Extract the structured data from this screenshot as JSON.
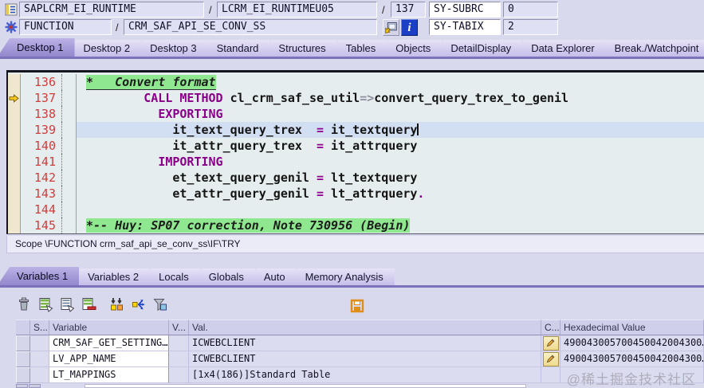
{
  "topbar": {
    "separator": "/",
    "program_field": "SAPLCRM_EI_RUNTIME",
    "include_field": "LCRM_EI_RUNTIMEU05",
    "line_field": "137",
    "sy_subrc_label": "SY-SUBRC",
    "sy_subrc_value": "0",
    "event_type_field": "FUNCTION",
    "event_name_field": "CRM_SAF_API_SE_CONV_SS",
    "sy_tabix_label": "SY-TABIX",
    "sy_tabix_value": "2",
    "info_glyph": "i",
    "icons": [
      "abap-program-icon",
      "function-module-icon",
      "goto-statement-icon",
      "info-icon"
    ]
  },
  "desktop_tabs": [
    {
      "label": "Desktop 1",
      "active": true
    },
    {
      "label": "Desktop 2"
    },
    {
      "label": "Desktop 3"
    },
    {
      "label": "Standard"
    },
    {
      "label": "Structures"
    },
    {
      "label": "Tables"
    },
    {
      "label": "Objects"
    },
    {
      "label": "DetailDisplay"
    },
    {
      "label": "Data Explorer"
    },
    {
      "label": "Break./Watchpoint"
    }
  ],
  "code": {
    "current_line": "137",
    "lines": [
      {
        "num": "136",
        "segments": [
          {
            "t": "*   Convert format",
            "s": "cm",
            "mark": true,
            "u": true
          }
        ]
      },
      {
        "num": "137",
        "arrow": true,
        "segments": [
          {
            "t": "        "
          },
          {
            "t": "CALL METHOD",
            "s": "k"
          },
          {
            "t": " cl_crm_saf_se_util",
            "s": ""
          },
          {
            "t": "=>",
            "s": "o"
          },
          {
            "t": "convert_query_trex_to_genil",
            "s": ""
          }
        ]
      },
      {
        "num": "138",
        "segments": [
          {
            "t": "          "
          },
          {
            "t": "EXPORTING",
            "s": "k"
          }
        ]
      },
      {
        "num": "139",
        "hl": true,
        "caret": true,
        "segments": [
          {
            "t": "            it_text_query_trex  ",
            "s": ""
          },
          {
            "t": "=",
            "s": "k"
          },
          {
            "t": " it_textquery",
            "s": ""
          }
        ]
      },
      {
        "num": "140",
        "segments": [
          {
            "t": "            it_attr_query_trex  ",
            "s": ""
          },
          {
            "t": "=",
            "s": "k"
          },
          {
            "t": " it_attrquery",
            "s": ""
          }
        ]
      },
      {
        "num": "141",
        "segments": [
          {
            "t": "          "
          },
          {
            "t": "IMPORTING",
            "s": "k"
          }
        ]
      },
      {
        "num": "142",
        "segments": [
          {
            "t": "            et_text_query_genil ",
            "s": ""
          },
          {
            "t": "=",
            "s": "k"
          },
          {
            "t": " lt_textquery",
            "s": ""
          }
        ]
      },
      {
        "num": "143",
        "segments": [
          {
            "t": "            et_attr_query_genil ",
            "s": ""
          },
          {
            "t": "=",
            "s": "k"
          },
          {
            "t": " lt_attrquery",
            "s": ""
          },
          {
            "t": ".",
            "s": "k"
          }
        ]
      },
      {
        "num": "144",
        "segments": []
      },
      {
        "num": "145",
        "segments": [
          {
            "t": "*-- Huy: SP07 correction, Note 730956 (Begin)",
            "s": "cm",
            "mark": true
          }
        ]
      }
    ]
  },
  "scope_bar": {
    "text": "Scope \\FUNCTION crm_saf_api_se_conv_ss\\IF\\TRY"
  },
  "variable_tabs": [
    {
      "label": "Variables 1",
      "active": true
    },
    {
      "label": "Variables 2"
    },
    {
      "label": "Locals"
    },
    {
      "label": "Globals"
    },
    {
      "label": "Auto"
    },
    {
      "label": "Memory Analysis"
    }
  ],
  "toolbar": {
    "icons": [
      "delete-icon",
      "table-create-icon",
      "table-display-icon",
      "table-delete-row-icon",
      "insert-values-icon",
      "swap-arrows-icon",
      "filter-funnel-icon"
    ],
    "save_icon": "save-icon",
    "pencil_icon": "change-value-pencil-icon",
    "arrow_icon": "current-statement-arrow-icon"
  },
  "table": {
    "columns": [
      "",
      "S...",
      "Variable",
      "V...",
      "Val.",
      "C...",
      "Hexadecimal Value"
    ],
    "rows": [
      {
        "variable": "CRM_SAF_GET_SETTING…",
        "value": "ICWEBCLIENT",
        "changeable": true,
        "hex": "490043005700450042004300…"
      },
      {
        "variable": "LV_APP_NAME",
        "value": "ICWEBCLIENT",
        "changeable": true,
        "hex": "490043005700450042004300…"
      },
      {
        "variable": "LT_MAPPINGS",
        "value": "[1x4(186)]Standard Table",
        "changeable": false,
        "hex": ""
      }
    ]
  },
  "watermark": "@稀土掘金技术社区",
  "colors": {
    "window_bg": "#d9d9ed",
    "active_tab": "#9a8fd2",
    "tab_underline": "#7b72ba",
    "code_bg": "#e5edee",
    "comment_highlight": "#8fe88f",
    "current_line_highlight": "#d2def2",
    "keyword": "#8b008b",
    "line_number": "#d23c3c",
    "table_header_bg": "#cfcfe9",
    "pencil_button_bg": "#f2e4a0"
  }
}
